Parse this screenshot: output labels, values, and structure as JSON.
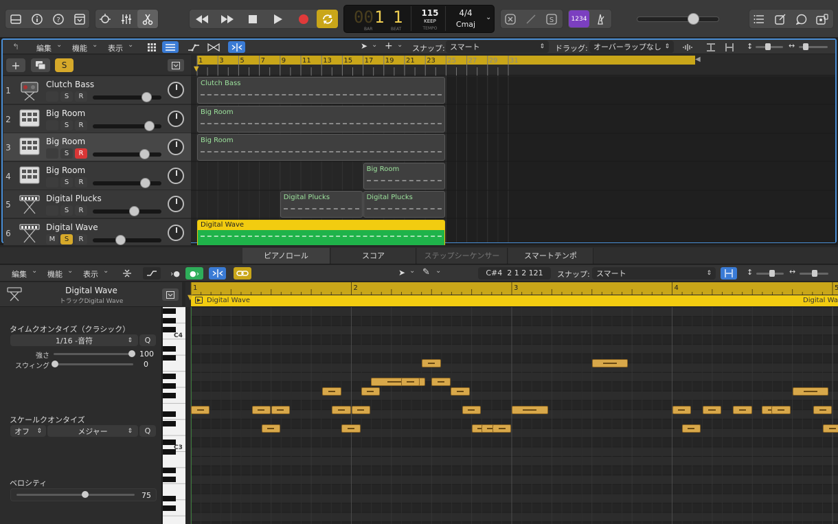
{
  "transport": {
    "bar_prefix": "00",
    "bar": "1",
    "beat": "1",
    "bar_caption": "BAR",
    "beat_caption": "BEAT",
    "tempo": "115",
    "tempo_mode": "KEEP",
    "tempo_caption": "TEMPO",
    "time_signature": "4/4",
    "key": "Cmaj",
    "count_in": "1234",
    "master_volume": 0.72
  },
  "tracks_toolbar": {
    "edit": "編集",
    "function": "機能",
    "view": "表示",
    "snap_label": "スナップ:",
    "snap_value": "スマート",
    "drag_label": "ドラッグ:",
    "drag_value": "オーバーラップなし"
  },
  "track_list_header": {
    "s_button": "S"
  },
  "tracks": [
    {
      "number": "1",
      "name": "Clutch Bass",
      "mute": "",
      "solo": "S",
      "record": "R",
      "volume": 0.78,
      "icon": "bass-amp-icon"
    },
    {
      "number": "2",
      "name": "Big Room",
      "mute": "",
      "solo": "S",
      "record": "R",
      "volume": 0.82,
      "icon": "drum-machine-icon"
    },
    {
      "number": "3",
      "name": "Big Room",
      "mute": "",
      "solo": "S",
      "record": "R",
      "volume": 0.75,
      "icon": "drum-machine-icon"
    },
    {
      "number": "4",
      "name": "Big Room",
      "mute": "",
      "solo": "S",
      "record": "R",
      "volume": 0.76,
      "icon": "drum-machine-icon"
    },
    {
      "number": "5",
      "name": "Digital Plucks",
      "mute": "",
      "solo": "S",
      "record": "R",
      "volume": 0.6,
      "icon": "keyboard-stand-icon"
    },
    {
      "number": "6",
      "name": "Digital Wave",
      "mute": "M",
      "solo": "S",
      "record": "R",
      "volume": 0.4,
      "icon": "keyboard-stand-icon"
    }
  ],
  "ruler": [
    "1",
    "3",
    "5",
    "7",
    "9",
    "11",
    "13",
    "15",
    "17",
    "19",
    "21",
    "23",
    "25",
    "27",
    "29",
    "31"
  ],
  "regions": [
    {
      "name": "Clutch Bass",
      "track": 0,
      "start": 1,
      "end": 25
    },
    {
      "name": "Big Room",
      "track": 1,
      "start": 1,
      "end": 25
    },
    {
      "name": "Big Room",
      "track": 2,
      "start": 1,
      "end": 25
    },
    {
      "name": "Big Room",
      "track": 3,
      "start": 17,
      "end": 25
    },
    {
      "name": "Digital Plucks",
      "track": 4,
      "start": 9,
      "end": 17
    },
    {
      "name": "Digital Plucks",
      "track": 4,
      "start": 17,
      "end": 25
    },
    {
      "name": "Digital Wave",
      "track": 5,
      "start": 1,
      "end": 25
    }
  ],
  "editor_tabs": [
    "ピアノロール",
    "スコア",
    "ステップシーケンサー",
    "スマートテンポ"
  ],
  "editor_toolbar": {
    "edit": "編集",
    "function": "機能",
    "view": "表示",
    "position": "C#4  2 1 2 121",
    "snap_label": "スナップ:",
    "snap_value": "スマート"
  },
  "inspector": {
    "region_name": "Digital Wave",
    "track_label": "トラックDigital Wave",
    "quantize_title": "タイムクオンタイズ（クラシック）",
    "quantize_value": "1/16 -音符",
    "q": "Q",
    "strength_label": "強さ",
    "strength_value": "100",
    "swing_label": "スウィング",
    "swing_value": "0",
    "scale_title": "スケールクオンタイズ",
    "scale_mode": "オフ",
    "scale_type": "メジャー",
    "velocity_title": "ベロシティ",
    "velocity_value": "75"
  },
  "piano": {
    "c4": "C4",
    "c3": "C3"
  },
  "editor_ruler": [
    "1",
    "2",
    "3",
    "4",
    "5"
  ],
  "editor_region": {
    "name": "Digital Wave",
    "name_right": "Digital Wave"
  },
  "notes": [
    {
      "beat": 1.0,
      "len": 0.13,
      "row": 8
    },
    {
      "beat": 1.38,
      "len": 0.13,
      "row": 8
    },
    {
      "beat": 1.44,
      "len": 0.13,
      "row": 10
    },
    {
      "beat": 1.5,
      "len": 0.13,
      "row": 8
    },
    {
      "beat": 1.82,
      "len": 0.13,
      "row": 6
    },
    {
      "beat": 1.88,
      "len": 0.13,
      "row": 8
    },
    {
      "beat": 1.94,
      "len": 0.13,
      "row": 10
    },
    {
      "beat": 2.0,
      "len": 0.13,
      "row": 8
    },
    {
      "beat": 2.06,
      "len": 0.13,
      "row": 6
    },
    {
      "beat": 2.12,
      "len": 0.38,
      "row": 5
    },
    {
      "beat": 2.31,
      "len": 0.13,
      "row": 5
    },
    {
      "beat": 2.44,
      "len": 0.13,
      "row": 3
    },
    {
      "beat": 2.5,
      "len": 0.13,
      "row": 5
    },
    {
      "beat": 2.62,
      "len": 0.13,
      "row": 6
    },
    {
      "beat": 2.69,
      "len": 0.13,
      "row": 8
    },
    {
      "beat": 2.75,
      "len": 0.13,
      "row": 10
    },
    {
      "beat": 2.81,
      "len": 0.13,
      "row": 10
    },
    {
      "beat": 2.88,
      "len": 0.13,
      "row": 10
    },
    {
      "beat": 3.0,
      "len": 0.25,
      "row": 8
    },
    {
      "beat": 3.5,
      "len": 0.25,
      "row": 3
    },
    {
      "beat": 4.0,
      "len": 0.13,
      "row": 8
    },
    {
      "beat": 4.06,
      "len": 0.13,
      "row": 10
    },
    {
      "beat": 4.19,
      "len": 0.13,
      "row": 8
    },
    {
      "beat": 4.38,
      "len": 0.13,
      "row": 8
    },
    {
      "beat": 4.56,
      "len": 0.13,
      "row": 8
    },
    {
      "beat": 4.62,
      "len": 0.13,
      "row": 8
    },
    {
      "beat": 4.75,
      "len": 0.25,
      "row": 6
    },
    {
      "beat": 4.88,
      "len": 0.13,
      "row": 8
    },
    {
      "beat": 4.94,
      "len": 0.13,
      "row": 10
    }
  ]
}
